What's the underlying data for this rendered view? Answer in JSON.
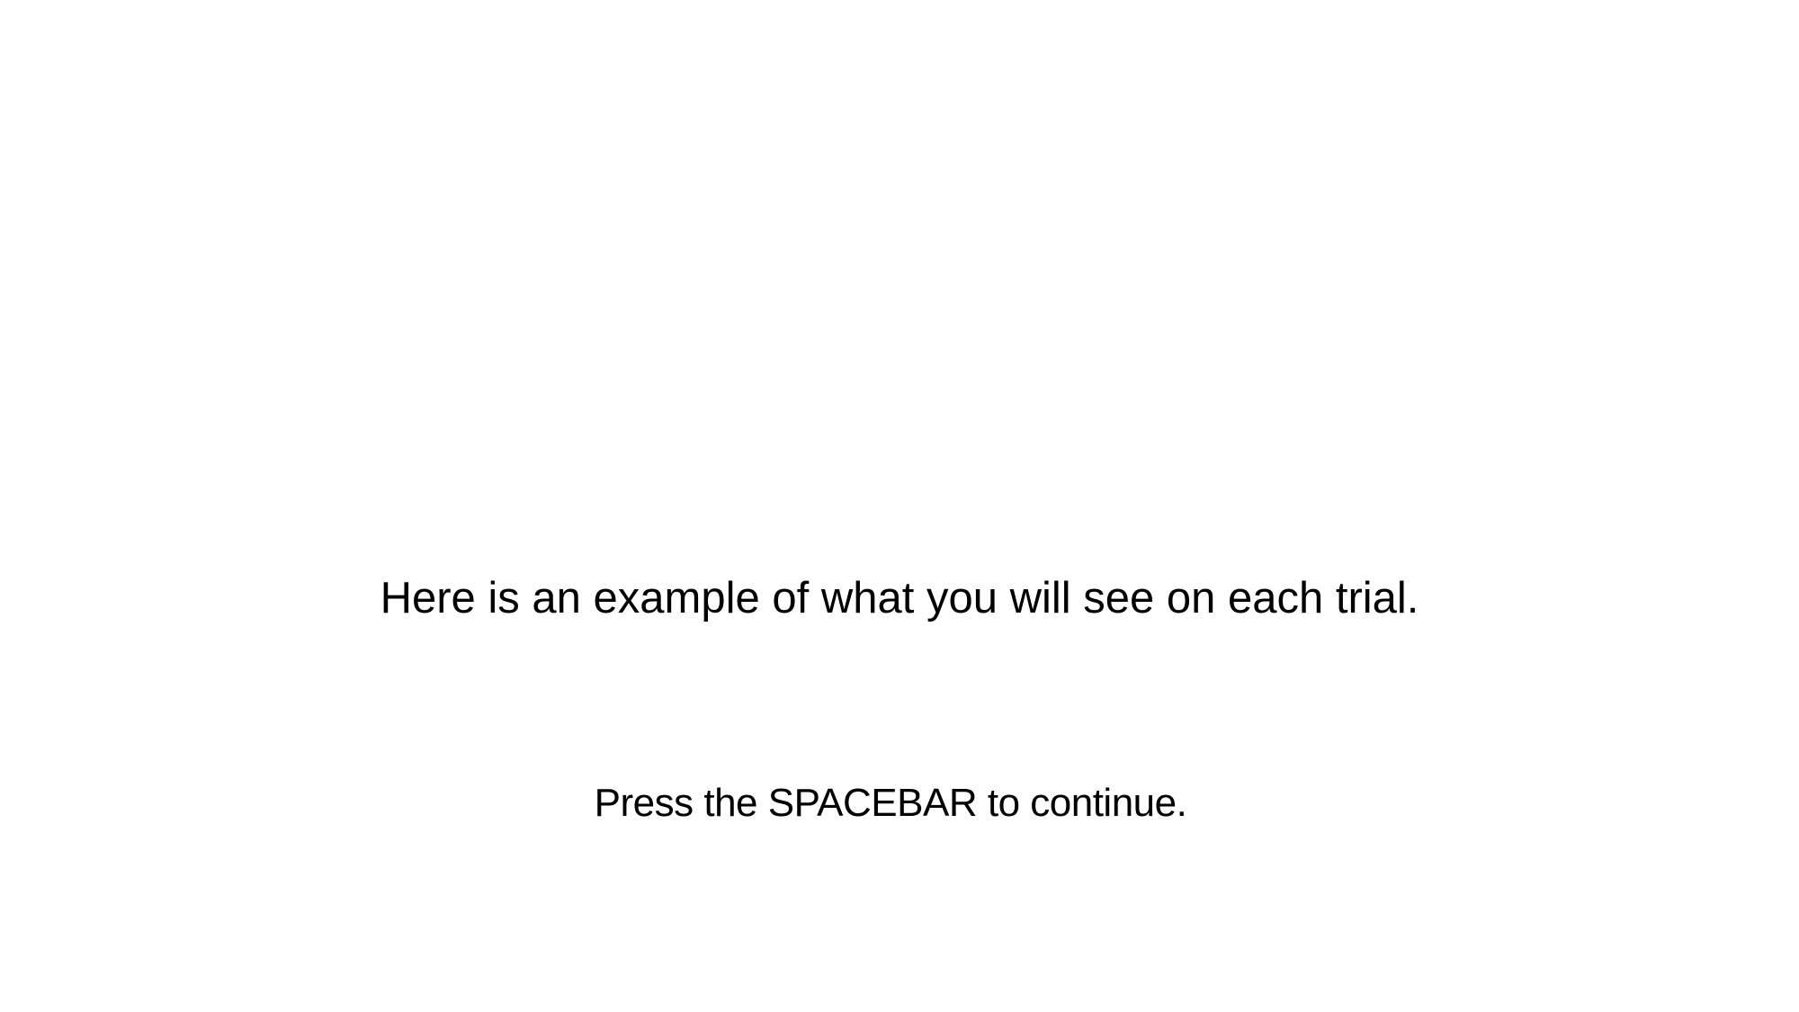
{
  "screen": {
    "instruction_text": "Here is an example of what you will see on each trial.",
    "continue_prompt": "Press the SPACEBAR to continue."
  },
  "colors": {
    "background": "#ffffff",
    "text": "#000000"
  }
}
